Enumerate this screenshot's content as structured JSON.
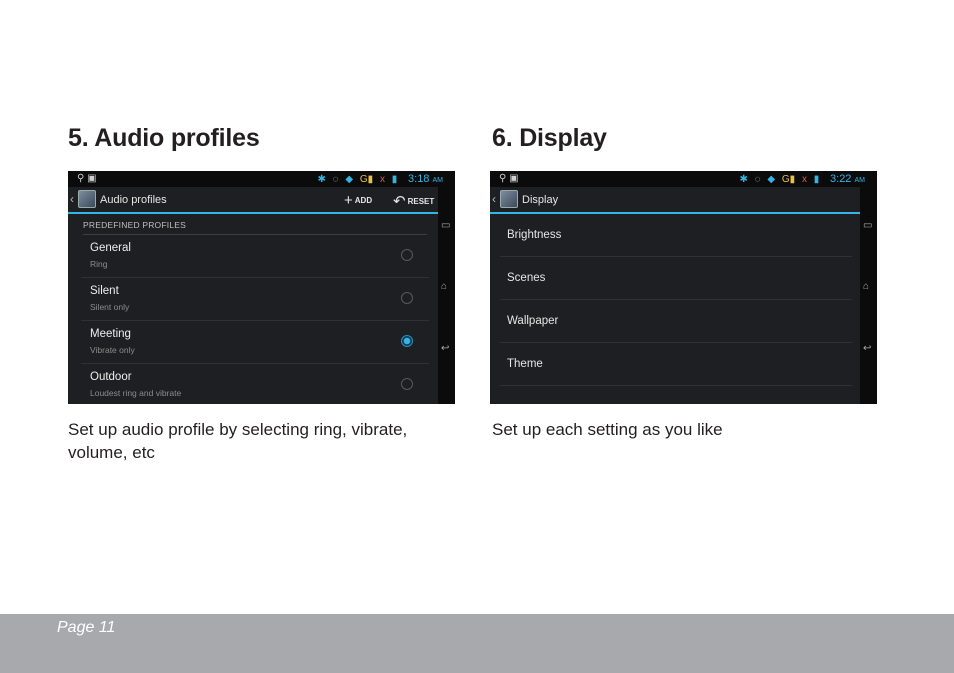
{
  "sections": [
    {
      "title": "5. Audio profiles",
      "caption_line1": "Set up audio profile by selecting ring, vibrate,",
      "caption_line2": "volume, etc",
      "screen": {
        "status_time": "3:18",
        "status_ampm": "AM",
        "action_title": "Audio profiles",
        "add_label": "ADD",
        "reset_label": "RESET",
        "subheader": "PREDEFINED PROFILES",
        "profiles": [
          {
            "name": "General",
            "sub": "Ring",
            "selected": false
          },
          {
            "name": "Silent",
            "sub": "Silent only",
            "selected": false
          },
          {
            "name": "Meeting",
            "sub": "Vibrate only",
            "selected": true
          },
          {
            "name": "Outdoor",
            "sub": "Loudest ring and vibrate",
            "selected": false
          }
        ]
      }
    },
    {
      "title": "6. Display",
      "caption_line1": "Set up each setting as you like",
      "screen": {
        "status_time": "3:22",
        "status_ampm": "AM",
        "action_title": "Display",
        "items": [
          "Brightness",
          "Scenes",
          "Wallpaper",
          "Theme"
        ]
      }
    }
  ],
  "footer": {
    "page_label": "Page 11"
  },
  "colors": {
    "accent": "#33b5e5",
    "footer_bg": "#a7a9ac",
    "screen_bg": "#1d1f22"
  },
  "icons": [
    "usb-icon",
    "image-icon",
    "bluetooth-icon",
    "sync-icon",
    "wifi-icon",
    "signal-icon",
    "battery-icon",
    "back-icon",
    "home-icon",
    "recent-apps-icon"
  ]
}
